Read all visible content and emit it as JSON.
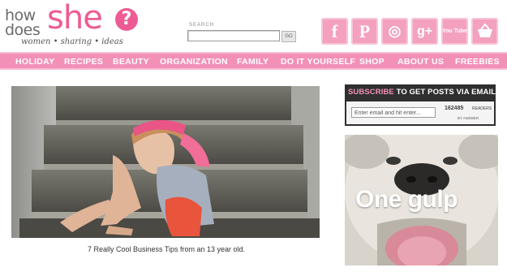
{
  "logo": {
    "line1": "how",
    "line2": "does",
    "brand": "she",
    "mark": "?",
    "tagline": "women • sharing • ideas"
  },
  "search": {
    "label": "SEARCH",
    "placeholder": "",
    "button": "GO"
  },
  "social": [
    {
      "name": "facebook-icon",
      "glyph": "f"
    },
    {
      "name": "pinterest-icon",
      "glyph": "P"
    },
    {
      "name": "instagram-icon",
      "glyph": "◎"
    },
    {
      "name": "google-plus-icon",
      "glyph": "g+"
    },
    {
      "name": "youtube-icon",
      "glyph": "You Tube"
    },
    {
      "name": "shop-basket-icon",
      "glyph": ""
    }
  ],
  "nav": [
    "HOLIDAY",
    "RECIPES",
    "BEAUTY",
    "ORGANIZATION",
    "FAMILY",
    "DO IT YOURSELF",
    "SHOP",
    "ABOUT US",
    "FREEBIES"
  ],
  "post": {
    "caption": "7 Really Cool Business Tips from an 13 year old."
  },
  "subscribe": {
    "title_highlight": "SUBSCRIBE",
    "title_rest": " TO GET POSTS VIA EMAIL",
    "email_placeholder": "Enter email and hit enter...",
    "count": "162485",
    "readers": "READERS",
    "by": "BY AWEBER"
  },
  "ad": {
    "text": "One gulp"
  },
  "colors": {
    "brand_pink": "#ee5b94",
    "nav_pink": "#f390b7",
    "social_pink": "#f3a1bf",
    "subscribe_bg": "#2f2f2f"
  }
}
